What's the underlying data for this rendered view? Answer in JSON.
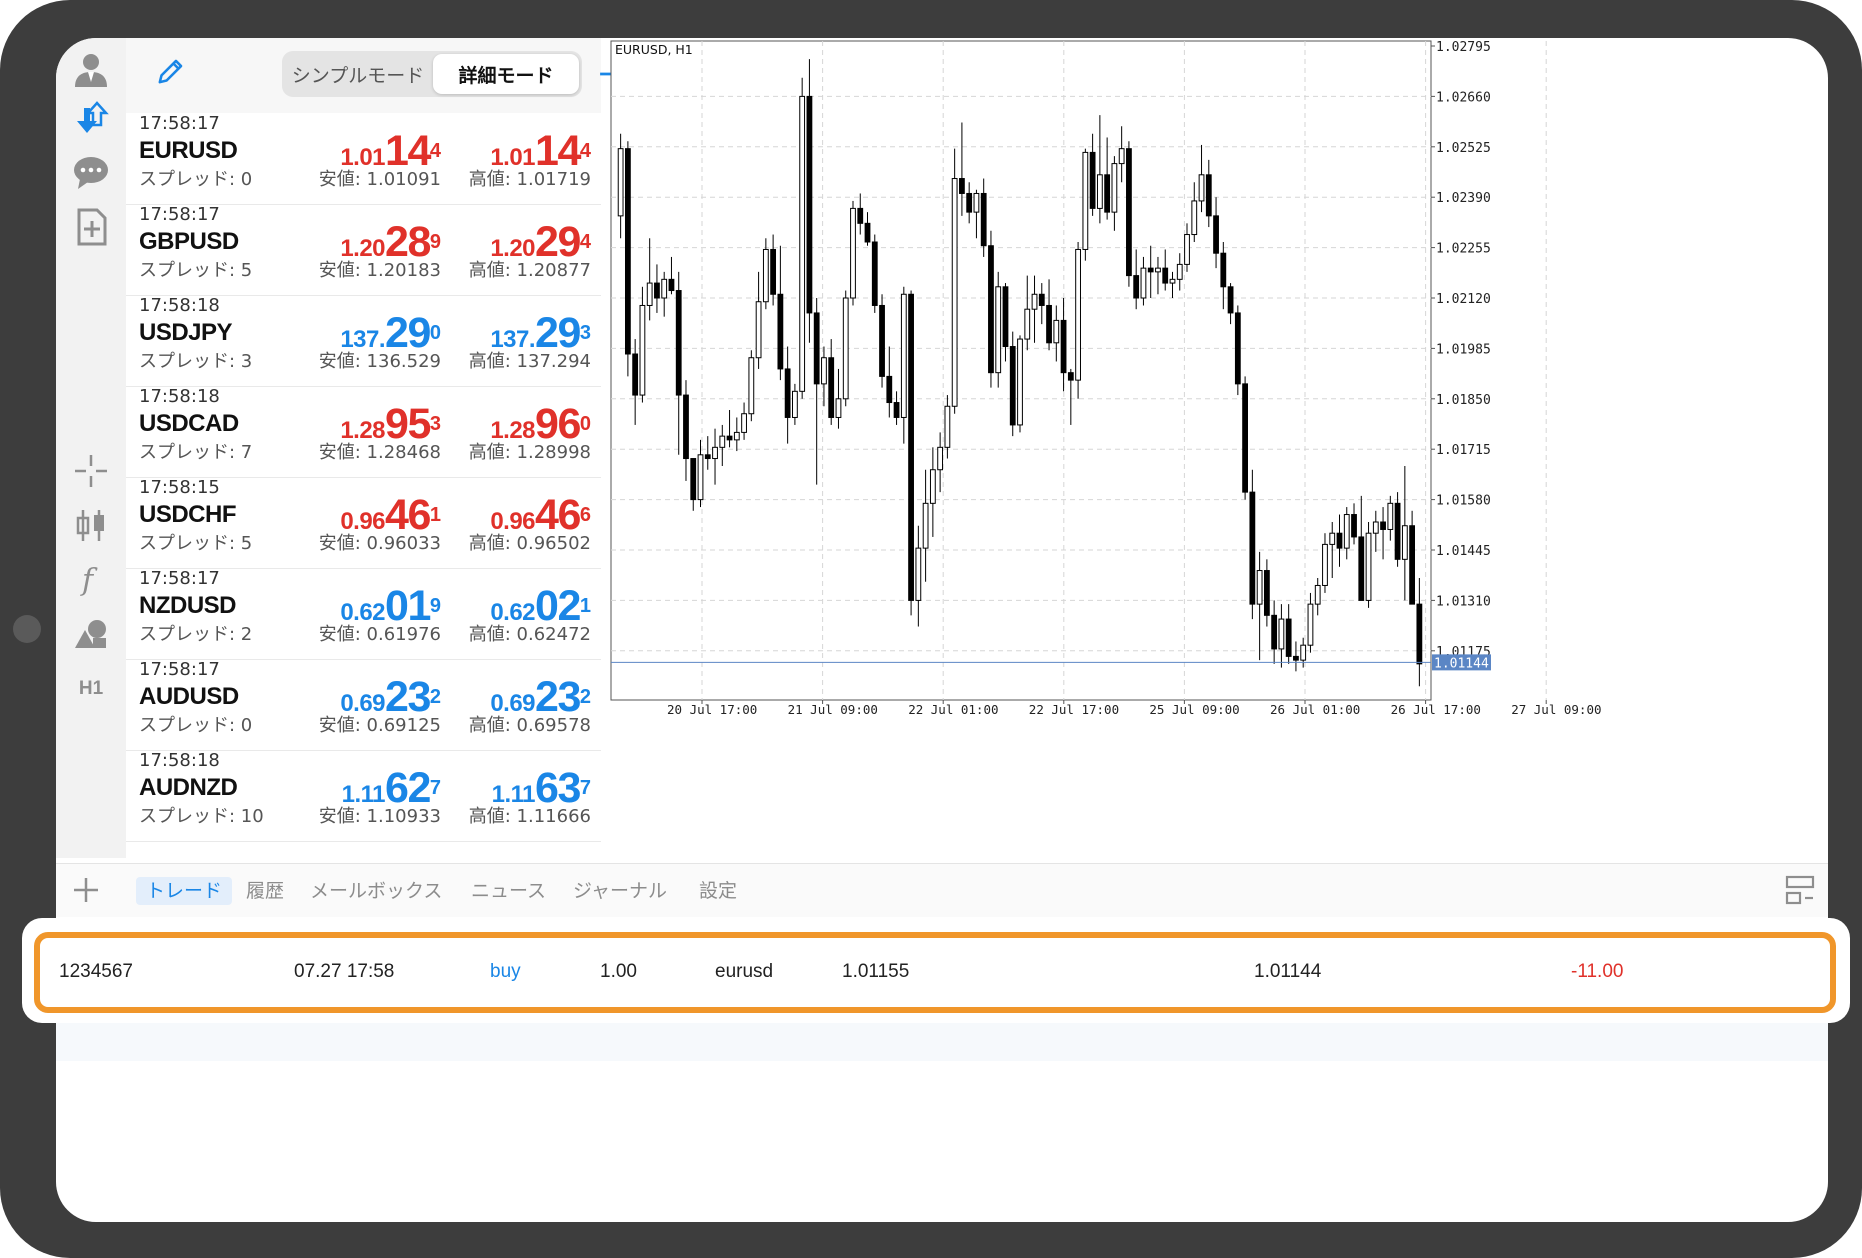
{
  "header": {
    "simple_mode": "シンプルモード",
    "detail_mode": "詳細モード"
  },
  "rail": {
    "h1_label": "H1"
  },
  "colors": {
    "sell": "#e0312a",
    "buy": "#1a86e6",
    "highlight": "#f0962a"
  },
  "quotes": [
    {
      "time": "17:58:17",
      "symbol": "EURUSD",
      "spread": "スプレッド: 0",
      "color": "red",
      "bid": {
        "small": "1.01",
        "big": "14",
        "pip": "4"
      },
      "ask": {
        "small": "1.01",
        "big": "14",
        "pip": "4"
      },
      "low": "安値: 1.01091",
      "high": "高値: 1.01719"
    },
    {
      "time": "17:58:17",
      "symbol": "GBPUSD",
      "spread": "スプレッド: 5",
      "color": "red",
      "bid": {
        "small": "1.20",
        "big": "28",
        "pip": "9"
      },
      "ask": {
        "small": "1.20",
        "big": "29",
        "pip": "4"
      },
      "low": "安値: 1.20183",
      "high": "高値: 1.20877"
    },
    {
      "time": "17:58:18",
      "symbol": "USDJPY",
      "spread": "スプレッド: 3",
      "color": "blue",
      "bid": {
        "small": "137.",
        "big": "29",
        "pip": "0"
      },
      "ask": {
        "small": "137.",
        "big": "29",
        "pip": "3"
      },
      "low": "安値: 136.529",
      "high": "高値: 137.294"
    },
    {
      "time": "17:58:18",
      "symbol": "USDCAD",
      "spread": "スプレッド: 7",
      "color": "red",
      "bid": {
        "small": "1.28",
        "big": "95",
        "pip": "3"
      },
      "ask": {
        "small": "1.28",
        "big": "96",
        "pip": "0"
      },
      "low": "安値: 1.28468",
      "high": "高値: 1.28998"
    },
    {
      "time": "17:58:15",
      "symbol": "USDCHF",
      "spread": "スプレッド: 5",
      "color": "red",
      "bid": {
        "small": "0.96",
        "big": "46",
        "pip": "1"
      },
      "ask": {
        "small": "0.96",
        "big": "46",
        "pip": "6"
      },
      "low": "安値: 0.96033",
      "high": "高値: 0.96502"
    },
    {
      "time": "17:58:17",
      "symbol": "NZDUSD",
      "spread": "スプレッド: 2",
      "color": "blue",
      "bid": {
        "small": "0.62",
        "big": "01",
        "pip": "9"
      },
      "ask": {
        "small": "0.62",
        "big": "02",
        "pip": "1"
      },
      "low": "安値: 0.61976",
      "high": "高値: 0.62472"
    },
    {
      "time": "17:58:17",
      "symbol": "AUDUSD",
      "spread": "スプレッド: 0",
      "color": "blue",
      "bid": {
        "small": "0.69",
        "big": "23",
        "pip": "2"
      },
      "ask": {
        "small": "0.69",
        "big": "23",
        "pip": "2"
      },
      "low": "安値: 0.69125",
      "high": "高値: 0.69578"
    },
    {
      "time": "17:58:18",
      "symbol": "AUDNZD",
      "spread": "スプレッド: 10",
      "color": "blue",
      "bid": {
        "small": "1.11",
        "big": "62",
        "pip": "7"
      },
      "ask": {
        "small": "1.11",
        "big": "63",
        "pip": "7"
      },
      "low": "安値: 1.10933",
      "high": "高値: 1.11666"
    }
  ],
  "chart": {
    "title": "EURUSD, H1",
    "current_price": "1.01144",
    "y_ticks": [
      "1.02795",
      "1.02660",
      "1.02525",
      "1.02390",
      "1.02255",
      "1.02120",
      "1.01985",
      "1.01850",
      "1.01715",
      "1.01580",
      "1.01445",
      "1.01310",
      "1.01175"
    ],
    "x_ticks": [
      "20 Jul 17:00",
      "21 Jul 09:00",
      "22 Jul 01:00",
      "22 Jul 17:00",
      "25 Jul 09:00",
      "26 Jul 01:00",
      "26 Jul 17:00",
      "27 Jul 09:00"
    ]
  },
  "chart_data": {
    "type": "candlestick",
    "title": "EURUSD, H1",
    "ylim": [
      1.011,
      1.028
    ],
    "current_price": 1.01144,
    "grid": true,
    "ohlc": [
      [
        1.0234,
        1.0256,
        1.0228,
        1.0252
      ],
      [
        1.0252,
        1.0254,
        1.0191,
        1.0197
      ],
      [
        1.0197,
        1.0201,
        1.0178,
        1.0186
      ],
      [
        1.0186,
        1.0215,
        1.0184,
        1.021
      ],
      [
        1.021,
        1.0228,
        1.0206,
        1.0216
      ],
      [
        1.0216,
        1.0221,
        1.0208,
        1.0212
      ],
      [
        1.0212,
        1.0219,
        1.0207,
        1.0217
      ],
      [
        1.0217,
        1.0223,
        1.0213,
        1.0214
      ],
      [
        1.0214,
        1.0219,
        1.017,
        1.0186
      ],
      [
        1.0186,
        1.019,
        1.0163,
        1.0169
      ],
      [
        1.0169,
        1.016,
        1.0155,
        1.0158
      ],
      [
        1.0158,
        1.0174,
        1.0156,
        1.017
      ],
      [
        1.017,
        1.0175,
        1.0166,
        1.0169
      ],
      [
        1.0169,
        1.0177,
        1.0162,
        1.0172
      ],
      [
        1.0172,
        1.0178,
        1.0167,
        1.0175
      ],
      [
        1.0175,
        1.0182,
        1.0172,
        1.0174
      ],
      [
        1.0174,
        1.018,
        1.0171,
        1.0176
      ],
      [
        1.0176,
        1.0184,
        1.0174,
        1.0181
      ],
      [
        1.0181,
        1.0198,
        1.0179,
        1.0196
      ],
      [
        1.0196,
        1.0219,
        1.0193,
        1.0211
      ],
      [
        1.0211,
        1.0228,
        1.0209,
        1.0225
      ],
      [
        1.0225,
        1.0229,
        1.021,
        1.0213
      ],
      [
        1.0213,
        1.0226,
        1.019,
        1.0193
      ],
      [
        1.0193,
        1.0199,
        1.0173,
        1.018
      ],
      [
        1.018,
        1.0189,
        1.0178,
        1.0187
      ],
      [
        1.0187,
        1.0271,
        1.0185,
        1.0266
      ],
      [
        1.0266,
        1.0276,
        1.02,
        1.0208
      ],
      [
        1.0208,
        1.0212,
        1.0162,
        1.0189
      ],
      [
        1.0189,
        1.0199,
        1.0183,
        1.0196
      ],
      [
        1.0196,
        1.0201,
        1.0178,
        1.018
      ],
      [
        1.018,
        1.0193,
        1.0177,
        1.0185
      ],
      [
        1.0185,
        1.0214,
        1.0183,
        1.0212
      ],
      [
        1.0212,
        1.0238,
        1.021,
        1.0236
      ],
      [
        1.0236,
        1.024,
        1.0229,
        1.0232
      ],
      [
        1.0232,
        1.0235,
        1.0226,
        1.0227
      ],
      [
        1.0227,
        1.0229,
        1.0208,
        1.021
      ],
      [
        1.021,
        1.0213,
        1.0188,
        1.0191
      ],
      [
        1.0191,
        1.0199,
        1.018,
        1.0184
      ],
      [
        1.0184,
        1.0187,
        1.0178,
        1.018
      ],
      [
        1.018,
        1.0215,
        1.0173,
        1.0213
      ],
      [
        1.0213,
        1.0214,
        1.0127,
        1.0131
      ],
      [
        1.0131,
        1.0151,
        1.0124,
        1.0145
      ],
      [
        1.0145,
        1.0166,
        1.0136,
        1.0157
      ],
      [
        1.0157,
        1.0172,
        1.0148,
        1.0166
      ],
      [
        1.0166,
        1.0176,
        1.016,
        1.0172
      ],
      [
        1.0172,
        1.0186,
        1.0169,
        1.0183
      ],
      [
        1.0183,
        1.0252,
        1.0181,
        1.0244
      ],
      [
        1.0244,
        1.0259,
        1.0234,
        1.024
      ],
      [
        1.024,
        1.0243,
        1.0232,
        1.0235
      ],
      [
        1.0235,
        1.0241,
        1.0228,
        1.024
      ],
      [
        1.024,
        1.0244,
        1.0223,
        1.0226
      ],
      [
        1.0226,
        1.023,
        1.0188,
        1.0192
      ],
      [
        1.0192,
        1.0219,
        1.0188,
        1.0215
      ],
      [
        1.0215,
        1.0216,
        1.0195,
        1.0199
      ],
      [
        1.0199,
        1.0203,
        1.0175,
        1.0178
      ],
      [
        1.0178,
        1.0202,
        1.0176,
        1.0201
      ],
      [
        1.0201,
        1.0218,
        1.0198,
        1.0209
      ],
      [
        1.0209,
        1.0218,
        1.02,
        1.0213
      ],
      [
        1.0213,
        1.0216,
        1.0205,
        1.021
      ],
      [
        1.021,
        1.0217,
        1.0198,
        1.02
      ],
      [
        1.02,
        1.021,
        1.0195,
        1.0206
      ],
      [
        1.0206,
        1.0212,
        1.0187,
        1.0192
      ],
      [
        1.0192,
        1.0193,
        1.0178,
        1.019
      ],
      [
        1.019,
        1.0227,
        1.0185,
        1.0225
      ],
      [
        1.0225,
        1.0252,
        1.0222,
        1.0251
      ],
      [
        1.0251,
        1.0256,
        1.0234,
        1.0236
      ],
      [
        1.0236,
        1.0261,
        1.0232,
        1.0245
      ],
      [
        1.0245,
        1.0255,
        1.0233,
        1.0235
      ],
      [
        1.0235,
        1.025,
        1.023,
        1.0248
      ],
      [
        1.0248,
        1.0258,
        1.0243,
        1.0252
      ],
      [
        1.0252,
        1.0254,
        1.0215,
        1.0218
      ],
      [
        1.0218,
        1.0225,
        1.0209,
        1.0212
      ],
      [
        1.0212,
        1.0223,
        1.021,
        1.022
      ],
      [
        1.022,
        1.0226,
        1.0212,
        1.0219
      ],
      [
        1.0219,
        1.0223,
        1.0213,
        1.022
      ],
      [
        1.022,
        1.0225,
        1.0214,
        1.0216
      ],
      [
        1.0216,
        1.0219,
        1.0212,
        1.0217
      ],
      [
        1.0217,
        1.0224,
        1.0214,
        1.0221
      ],
      [
        1.0221,
        1.0232,
        1.0219,
        1.0229
      ],
      [
        1.0229,
        1.0243,
        1.0227,
        1.0238
      ],
      [
        1.0238,
        1.0253,
        1.0235,
        1.0245
      ],
      [
        1.0245,
        1.0249,
        1.0231,
        1.0234
      ],
      [
        1.0234,
        1.0239,
        1.022,
        1.0224
      ],
      [
        1.0224,
        1.0227,
        1.0209,
        1.0215
      ],
      [
        1.0215,
        1.0216,
        1.0205,
        1.0208
      ],
      [
        1.0208,
        1.021,
        1.0186,
        1.0189
      ],
      [
        1.0189,
        1.0191,
        1.0158,
        1.016
      ],
      [
        1.016,
        1.0166,
        1.0126,
        1.013
      ],
      [
        1.013,
        1.0144,
        1.0115,
        1.0139
      ],
      [
        1.0139,
        1.0142,
        1.0124,
        1.0127
      ],
      [
        1.0127,
        1.0131,
        1.0114,
        1.0118
      ],
      [
        1.0118,
        1.013,
        1.0113,
        1.0126
      ],
      [
        1.0126,
        1.013,
        1.0114,
        1.0116
      ],
      [
        1.0116,
        1.012,
        1.0112,
        1.0115
      ],
      [
        1.0115,
        1.0121,
        1.0113,
        1.0119
      ],
      [
        1.0119,
        1.0133,
        1.0117,
        1.013
      ],
      [
        1.013,
        1.0137,
        1.0127,
        1.0135
      ],
      [
        1.0135,
        1.0149,
        1.0133,
        1.0146
      ],
      [
        1.0146,
        1.0152,
        1.0137,
        1.0149
      ],
      [
        1.0149,
        1.0154,
        1.014,
        1.0145
      ],
      [
        1.0145,
        1.0156,
        1.0142,
        1.0154
      ],
      [
        1.0154,
        1.0157,
        1.0146,
        1.0148
      ],
      [
        1.0148,
        1.0159,
        1.0139,
        1.0131
      ],
      [
        1.0131,
        1.0152,
        1.0129,
        1.0149
      ],
      [
        1.0149,
        1.0155,
        1.0144,
        1.0152
      ],
      [
        1.0152,
        1.0156,
        1.0142,
        1.015
      ],
      [
        1.015,
        1.0159,
        1.0147,
        1.0157
      ],
      [
        1.0157,
        1.016,
        1.014,
        1.0142
      ],
      [
        1.0142,
        1.0167,
        1.0131,
        1.0151
      ],
      [
        1.0151,
        1.0155,
        1.0133,
        1.013
      ],
      [
        1.013,
        1.0137,
        1.0108,
        1.0114
      ]
    ]
  },
  "bottom": {
    "tabs": [
      "トレード",
      "履歴",
      "メールボックス",
      "ニュース",
      "ジャーナル",
      "設定"
    ],
    "position": {
      "ticket": "1234567",
      "time": "07.27 17:58",
      "type": "buy",
      "volume": "1.00",
      "symbol": "eurusd",
      "open_price": "1.01155",
      "current_price": "1.01144",
      "profit": "-11.00"
    }
  }
}
